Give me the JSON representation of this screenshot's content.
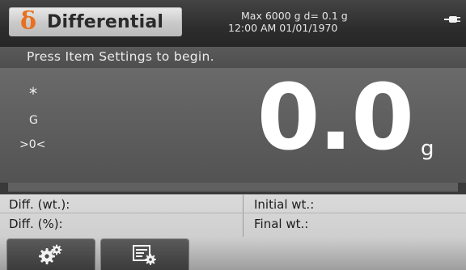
{
  "header": {
    "app_icon_glyph": "δ",
    "app_title": "Differential",
    "capacity_line": "Max 6000 g  d= 0.1 g",
    "datetime": "12:00 AM   01/01/1970",
    "power_icon": "plug-icon"
  },
  "status": {
    "message": "Press Item Settings to begin."
  },
  "display": {
    "stable_indicator": "*",
    "gross_indicator": "G",
    "center_zero_indicator": ">0<",
    "weight": "0.0",
    "unit": "g"
  },
  "capacity_bar": {
    "fill_fraction": 1.0
  },
  "results": {
    "diff_wt_label": "Diff. (wt.):",
    "diff_pct_label": "Diff. (%):",
    "initial_wt_label": "Initial wt.:",
    "final_wt_label": "Final wt.:"
  },
  "softkeys": [
    {
      "icon": "settings-gears-icon"
    },
    {
      "icon": "item-settings-icon"
    }
  ],
  "colors": {
    "accent": "#e8701f",
    "panel": "#5d5d5d",
    "results_bg": "#d4d4d4"
  }
}
